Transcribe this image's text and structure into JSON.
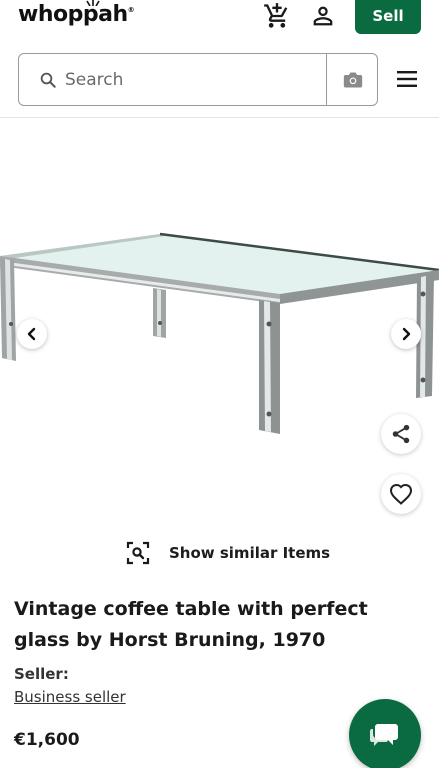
{
  "header": {
    "logo_text": "whoppah",
    "logo_mark": "®",
    "cart_icon": "cart-icon",
    "account_icon": "user-icon",
    "sell_label": "Sell",
    "brand_color": "#0b6b40"
  },
  "search": {
    "placeholder": "Search",
    "value": "",
    "search_icon": "search-icon",
    "camera_icon": "camera-icon"
  },
  "menu_icon": "hamburger-menu-icon",
  "gallery": {
    "prev_icon": "chevron-left-icon",
    "next_icon": "chevron-right-icon",
    "share_icon": "share-icon",
    "favorite_icon": "heart-icon"
  },
  "similar": {
    "icon": "image-search-icon",
    "label": "Show similar Items"
  },
  "product": {
    "title": "Vintage coffee table with perfect glass by Horst Bruning, 1970",
    "seller_label": "Seller:",
    "seller_type": "Business seller",
    "price": "€1,600"
  },
  "chat": {
    "icon": "chat-icon"
  }
}
